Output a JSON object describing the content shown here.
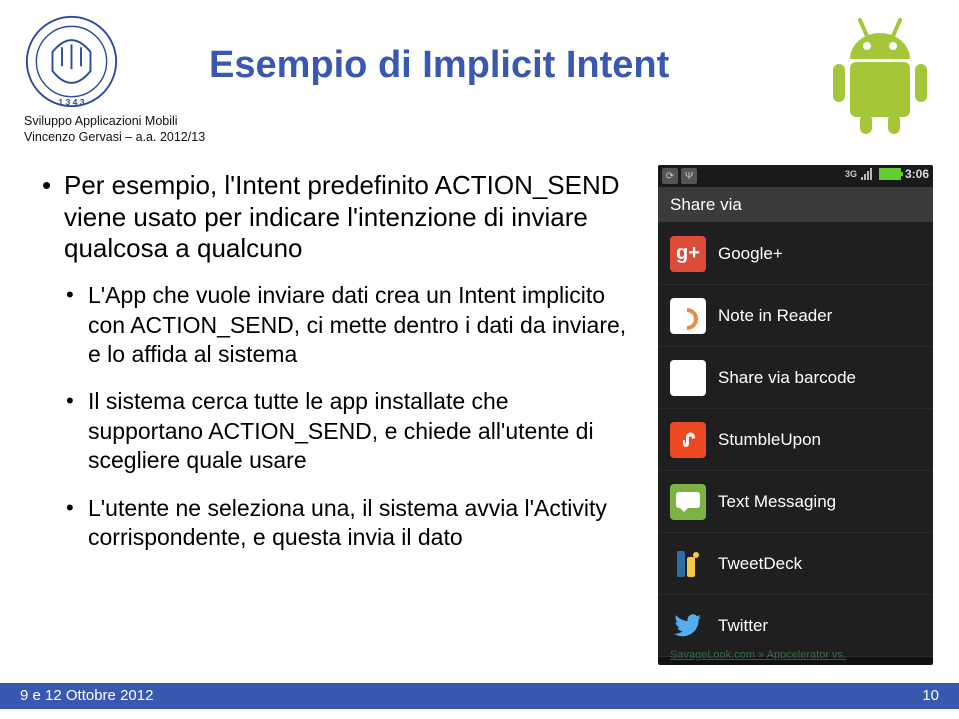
{
  "meta": {
    "line1": "Sviluppo Applicazioni Mobili",
    "line2": "Vincenzo Gervasi – a.a. 2012/13"
  },
  "title": "Esempio di Implicit Intent",
  "bullet_main": "Per esempio, l'Intent predefinito ACTION_SEND viene usato per indicare l'intenzione di inviare qualcosa a qualcuno",
  "sub": [
    "L'App che vuole inviare dati crea un Intent implicito con ACTION_SEND, ci mette dentro i dati da inviare, e lo affida al sistema",
    "Il sistema cerca tutte le app installate che supportano ACTION_SEND, e chiede all'utente di scegliere quale usare",
    "L'utente ne seleziona una, il sistema avvia l'Activity corrispondente, e questa invia il dato"
  ],
  "footer": {
    "date": "9 e 12 Ottobre 2012",
    "page": "10"
  },
  "phone": {
    "clock": "3:06",
    "net": "3G",
    "share_title": "Share via",
    "items": [
      {
        "label": "Google+",
        "icon": "gplus-icon"
      },
      {
        "label": "Note in Reader",
        "icon": "reader-icon"
      },
      {
        "label": "Share via barcode",
        "icon": "barcode-icon"
      },
      {
        "label": "StumbleUpon",
        "icon": "stumbleupon-icon"
      },
      {
        "label": "Text Messaging",
        "icon": "sms-icon"
      },
      {
        "label": "TweetDeck",
        "icon": "tweetdeck-icon"
      },
      {
        "label": "Twitter",
        "icon": "twitter-icon"
      }
    ],
    "bg_link": "SavageLook.com » Appcelerator vs."
  }
}
